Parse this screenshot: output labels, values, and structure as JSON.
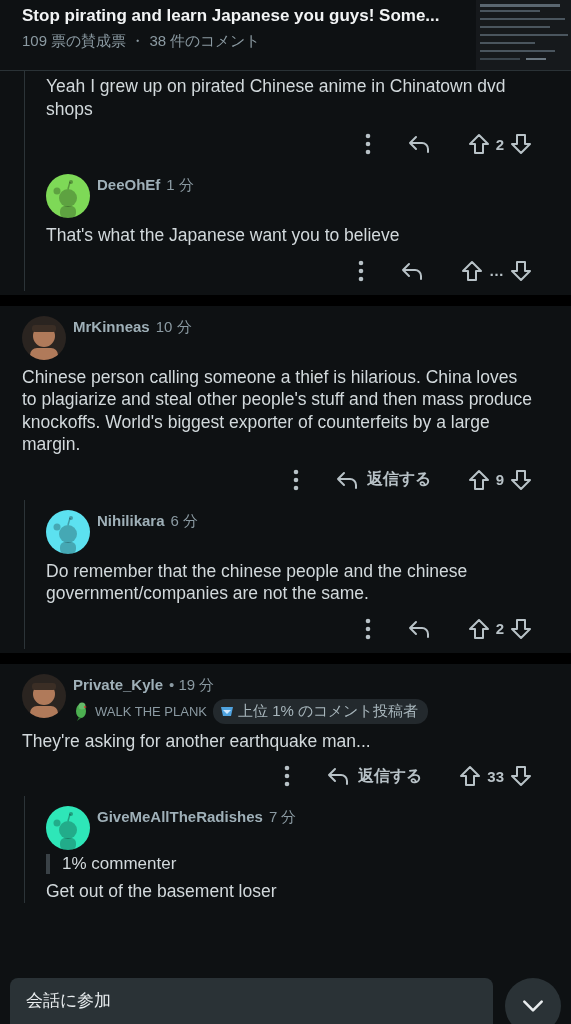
{
  "header": {
    "title": "Stop pirating and learn Japanese you guys! Some...",
    "stats": "109 票の賛成票 ・ 38 件のコメント"
  },
  "threads": [
    {
      "comments": [
        {
          "nested": true,
          "text": "Yeah I grew up on pirated Chinese anime in Chinatown dvd shops",
          "score": "2"
        },
        {
          "nested": true,
          "author": "DeeOhEf",
          "time": "1 分",
          "avatar": {
            "kind": "snoo",
            "color": "#7ed957"
          },
          "text": "That's what the Japanese want you to believe",
          "score": "…"
        }
      ]
    },
    {
      "comments": [
        {
          "nested": false,
          "author": "MrKinneas",
          "time": "10 分",
          "text": "Chinese person calling someone a thief is hilarious. China loves to plagiarize and steal other people's stuff and then mass produce knockoffs. World's biggest exporter of counterfeits by a large margin.",
          "reply_label": "返信する",
          "score": "9"
        },
        {
          "nested": true,
          "author": "Nihilikara",
          "time": "6 分",
          "avatar": {
            "kind": "snoo",
            "color": "#5ce1f0"
          },
          "text": "Do remember that the chinese people and the chinese government/companies are not the same.",
          "score": "2"
        }
      ]
    },
    {
      "comments": [
        {
          "nested": false,
          "author": "Private_Kyle",
          "time": "• 19 分",
          "flair": "WALK THE PLANK",
          "award": "上位 1% のコメント投稿者",
          "text": "They're asking for another earthquake man...",
          "reply_label": "返信する",
          "score": "33"
        },
        {
          "nested": true,
          "author": "GiveMeAllTheRadishes",
          "time": "7 分",
          "avatar": {
            "kind": "snoo",
            "color": "#2ee6b8"
          },
          "quote": "1% commenter",
          "text": "Get out of the basement loser"
        }
      ]
    }
  ],
  "composer": {
    "placeholder": "会話に参加"
  }
}
